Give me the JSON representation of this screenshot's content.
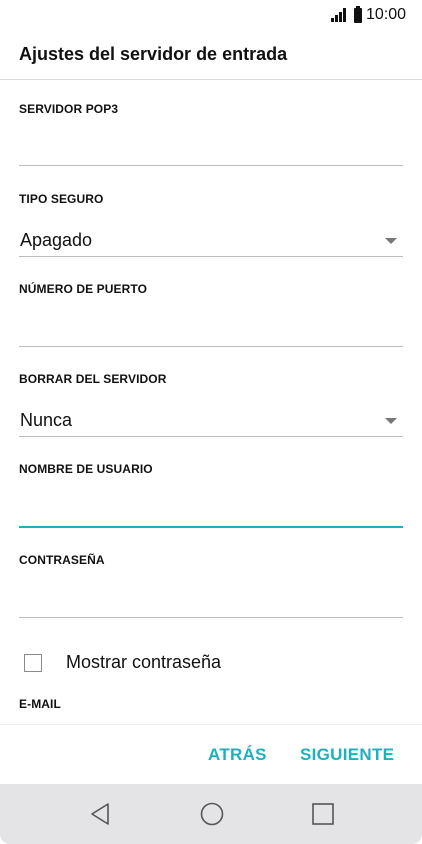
{
  "status_bar": {
    "time": "10:00",
    "signal_icon": "signal-bars-icon",
    "battery_icon": "battery-icon"
  },
  "header": {
    "title": "Ajustes del servidor de entrada"
  },
  "form": {
    "pop3_server": {
      "label": "SERVIDOR POP3",
      "value": ""
    },
    "security_type": {
      "label": "TIPO SEGURO",
      "value": "Apagado"
    },
    "port_number": {
      "label": "NÚMERO DE PUERTO",
      "value": ""
    },
    "delete_from_server": {
      "label": "BORRAR DEL SERVIDOR",
      "value": "Nunca"
    },
    "username": {
      "label": "NOMBRE DE USUARIO",
      "value": ""
    },
    "password": {
      "label": "CONTRASEÑA",
      "value": ""
    },
    "show_password": {
      "label": "Mostrar contraseña",
      "checked": false
    },
    "email": {
      "label": "E-MAIL"
    }
  },
  "actions": {
    "back_label": "ATRÁS",
    "next_label": "SIGUIENTE"
  },
  "colors": {
    "accent": "#1cb0c0",
    "nav_bar_bg": "#e4e4e6"
  },
  "nav_bar": {
    "back_icon": "back-triangle-icon",
    "home_icon": "home-circle-icon",
    "recents_icon": "recents-square-icon"
  }
}
